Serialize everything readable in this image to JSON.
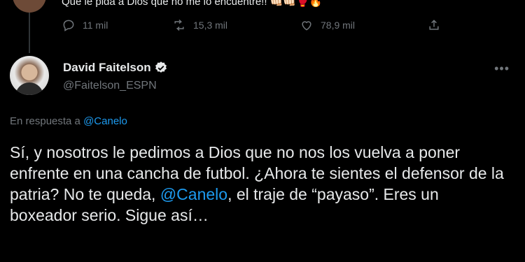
{
  "previous_tweet": {
    "text": "Que le pida a Dios que no me lo encuentre!! 👊🏻👊🏻🥊🔥",
    "replies": "11 mil",
    "retweets": "15,3 mil",
    "likes": "78,9 mil"
  },
  "tweet": {
    "author_name": "David Faitelson",
    "author_handle": "@Faitelson_ESPN",
    "more_menu": "•••",
    "reply_prefix": "En respuesta a",
    "reply_mention": "@Canelo",
    "body_part1": "Sí, y nosotros le pedimos a Dios que no nos los vuelva a poner enfrente en una cancha de futbol. ¿Ahora te sientes el defensor de la patria? No te queda, ",
    "body_mention": "@Canelo",
    "body_part2": ", el traje de “payaso”. Eres un boxeador serio. Sigue así…"
  },
  "colors": {
    "background": "#000000",
    "text": "#e7e9ea",
    "secondary": "#71767b",
    "accent": "#1d9bf0"
  },
  "icons": [
    "reply-icon",
    "retweet-icon",
    "like-icon",
    "share-icon",
    "verified-icon",
    "more-icon"
  ]
}
